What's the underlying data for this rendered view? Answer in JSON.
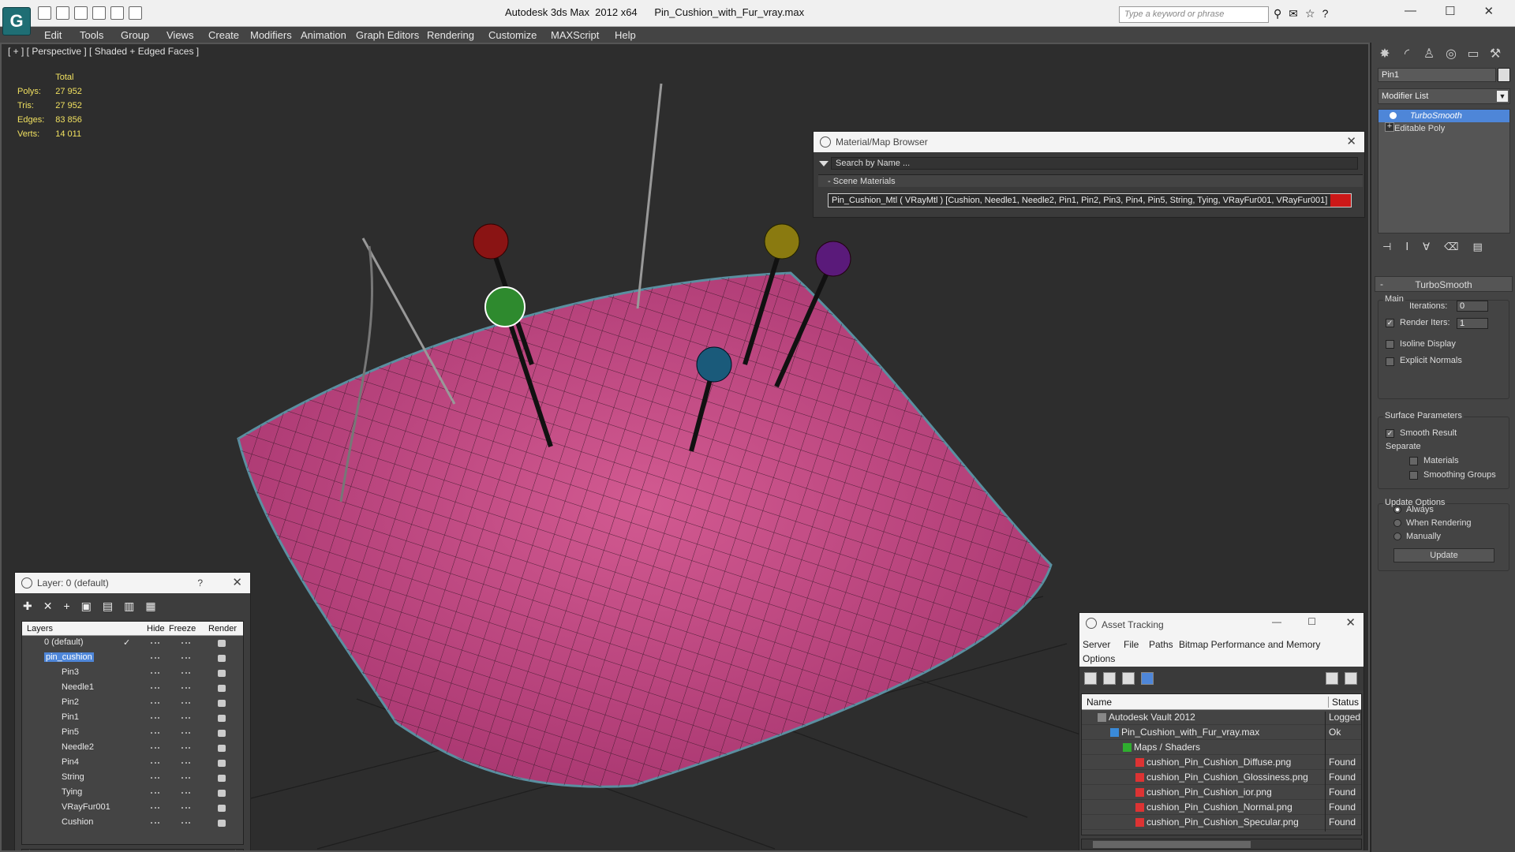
{
  "app": {
    "title": "Autodesk 3ds Max  2012 x64      Pin_Cushion_with_Fur_vray.max",
    "search_placeholder": "Type a keyword or phrase",
    "logo": "max-logo-icon"
  },
  "menu": [
    "Edit",
    "Tools",
    "Group",
    "Views",
    "Create",
    "Modifiers",
    "Animation",
    "Graph Editors",
    "Rendering",
    "Customize",
    "MAXScript",
    "Help"
  ],
  "viewport": {
    "label": "[ + ] [ Perspective ] [ Shaded + Edged Faces ]",
    "stats": {
      "header": "Total",
      "rows": [
        {
          "label": "Polys:",
          "value": "27 952"
        },
        {
          "label": "Tris:",
          "value": "27 952"
        },
        {
          "label": "Edges:",
          "value": "83 856"
        },
        {
          "label": "Verts:",
          "value": "14 011"
        }
      ]
    },
    "colors": {
      "cushion": "#c3447d",
      "grid": "#1e1e1e",
      "pin_red": "#8a1414",
      "pin_green": "#2e8a2e",
      "pin_yellow": "#8a7a10",
      "pin_purple": "#5a1a7a",
      "pin_blue": "#1a5a7a"
    }
  },
  "material_browser": {
    "title": "Material/Map Browser",
    "search": "Search by Name ...",
    "section": "Scene Materials",
    "material_row": "Pin_Cushion_Mtl  ( VRayMtl )  [Cushion, Needle1, Needle2, Pin1, Pin2, Pin3, Pin4, Pin5, String, Tying, VRayFur001, VRayFur001]"
  },
  "layer_manager": {
    "title": "Layer: 0 (default)",
    "help": "?",
    "columns": {
      "layers": "Layers",
      "hide": "Hide",
      "freeze": "Freeze",
      "render": "Render"
    },
    "rows": [
      {
        "name": "0 (default)",
        "level": 0
      },
      {
        "name": "pin_cushion",
        "level": 0
      },
      {
        "name": "Pin3",
        "level": 1
      },
      {
        "name": "Needle1",
        "level": 1
      },
      {
        "name": "Pin2",
        "level": 1
      },
      {
        "name": "Pin1",
        "level": 1
      },
      {
        "name": "Pin5",
        "level": 1
      },
      {
        "name": "Needle2",
        "level": 1
      },
      {
        "name": "Pin4",
        "level": 1
      },
      {
        "name": "String",
        "level": 1
      },
      {
        "name": "Tying",
        "level": 1
      },
      {
        "name": "VRayFur001",
        "level": 1
      },
      {
        "name": "Cushion",
        "level": 1
      }
    ]
  },
  "asset_tracking": {
    "title": "Asset Tracking",
    "menu": [
      "Server",
      "File",
      "Paths",
      "Bitmap Performance and Memory",
      "Options"
    ],
    "columns": {
      "name": "Name",
      "status": "Status"
    },
    "rows": [
      {
        "name": "Autodesk Vault 2012",
        "status": "Logged Out",
        "level": 0
      },
      {
        "name": "Pin_Cushion_with_Fur_vray.max",
        "status": "Ok",
        "level": 1
      },
      {
        "name": "Maps / Shaders",
        "status": "",
        "level": 2
      },
      {
        "name": "cushion_Pin_Cushion_Diffuse.png",
        "status": "Found",
        "level": 3
      },
      {
        "name": "cushion_Pin_Cushion_Glossiness.png",
        "status": "Found",
        "level": 3
      },
      {
        "name": "cushion_Pin_Cushion_ior.png",
        "status": "Found",
        "level": 3
      },
      {
        "name": "cushion_Pin_Cushion_Normal.png",
        "status": "Found",
        "level": 3
      },
      {
        "name": "cushion_Pin_Cushion_Specular.png",
        "status": "Found",
        "level": 3
      }
    ]
  },
  "command_panel": {
    "object_name": "Pin1",
    "modifier_list": "Modifier List",
    "stack": [
      "TurboSmooth",
      "Editable Poly"
    ],
    "rollout": "TurboSmooth",
    "main": "Main",
    "iterations_label": "Iterations:",
    "iterations": "0",
    "render_iters_label": "Render Iters:",
    "render_iters": "1",
    "isoline": "Isoline Display",
    "explicit": "Explicit Normals",
    "surface": "Surface Parameters",
    "smooth_result": "Smooth Result",
    "separate": "Separate",
    "materials": "Materials",
    "smoothing_groups": "Smoothing Groups",
    "update_options": "Update Options",
    "always": "Always",
    "when_rendering": "When Rendering",
    "manually": "Manually",
    "update": "Update"
  }
}
